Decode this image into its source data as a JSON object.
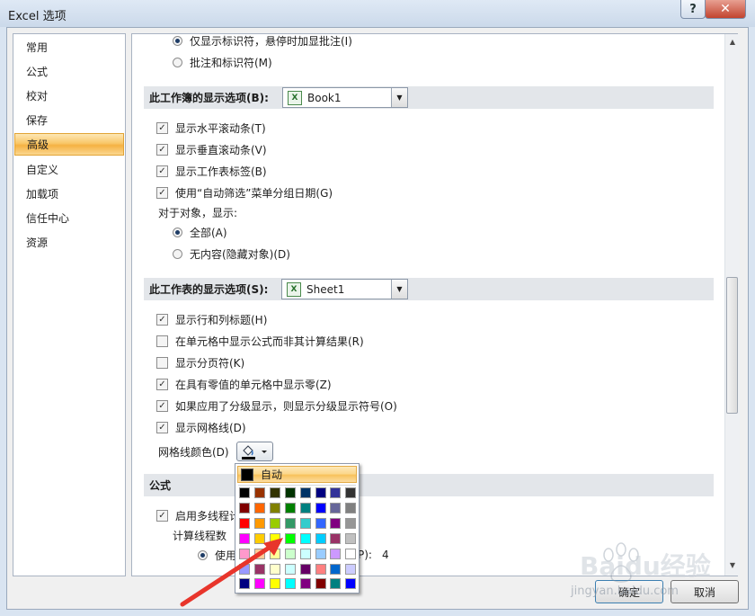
{
  "window": {
    "title": "Excel 选项",
    "help_label": "?",
    "close_label": "✕"
  },
  "nav": {
    "selected_index": 4,
    "items": [
      {
        "label": "常用"
      },
      {
        "label": "公式"
      },
      {
        "label": "校对"
      },
      {
        "label": "保存"
      },
      {
        "label": "高级"
      },
      {
        "label": "自定义"
      },
      {
        "label": "加载项"
      },
      {
        "label": "信任中心"
      },
      {
        "label": "资源"
      }
    ]
  },
  "comments": {
    "radio_indicators_only": "仅显示标识符，悬停时加显批注(I)",
    "radio_comments_and_indicators": "批注和标识符(M)",
    "indicators_only_selected": true,
    "comments_and_indicators_selected": false
  },
  "workbook_section": {
    "heading": "此工作簿的显示选项(B):",
    "combo_value": "Book1",
    "show_horizontal_scrollbar": "显示水平滚动条(T)",
    "show_vertical_scrollbar": "显示垂直滚动条(V)",
    "show_sheet_tabs": "显示工作表标签(B)",
    "group_dates_autofilter": "使用“自动筛选”菜单分组日期(G)",
    "objects_label": "对于对象，显示:",
    "objects_all": "全部(A)",
    "objects_nothing": "无内容(隐藏对象)(D)",
    "objects_all_selected": true,
    "objects_nothing_selected": false
  },
  "worksheet_section": {
    "heading": "此工作表的显示选项(S):",
    "combo_value": "Sheet1",
    "show_row_col_headers": {
      "label": "显示行和列标题(H)",
      "checked": true
    },
    "show_formulas": {
      "label": "在单元格中显示公式而非其计算结果(R)",
      "checked": false
    },
    "show_page_breaks": {
      "label": "显示分页符(K)",
      "checked": false
    },
    "show_zero": {
      "label": "在具有零值的单元格中显示零(Z)",
      "checked": true
    },
    "show_outline_symbols": {
      "label": "如果应用了分级显示，则显示分级显示符号(O)",
      "checked": true
    },
    "show_gridlines": {
      "label": "显示网格线(D)",
      "checked": true
    },
    "gridline_color_label": "网格线颜色(D)"
  },
  "formula_section": {
    "heading": "公式",
    "multithread_label": "启用多线程计",
    "threads_label": "计算线程数",
    "use_label": "使用",
    "p_suffix": "P):",
    "thread_count": "4"
  },
  "color_palette": {
    "auto_label": "自动",
    "auto_color": "#000000",
    "rows": [
      [
        "#000000",
        "#993300",
        "#333300",
        "#003300",
        "#003366",
        "#000080",
        "#333399",
        "#333333"
      ],
      [
        "#800000",
        "#FF6600",
        "#808000",
        "#008000",
        "#008080",
        "#0000FF",
        "#666699",
        "#808080"
      ],
      [
        "#FF0000",
        "#FF9900",
        "#99CC00",
        "#339966",
        "#33CCCC",
        "#3366FF",
        "#800080",
        "#969696"
      ],
      [
        "#FF00FF",
        "#FFCC00",
        "#FFFF00",
        "#00FF00",
        "#00FFFF",
        "#00CCFF",
        "#993366",
        "#C0C0C0"
      ],
      [
        "#FF99CC",
        "#FFCC99",
        "#FFFF99",
        "#CCFFCC",
        "#CCFFFF",
        "#99CCFF",
        "#CC99FF",
        "#FFFFFF"
      ],
      [
        "#9999FF",
        "#993366",
        "#FFFFCC",
        "#CCFFFF",
        "#660066",
        "#FF8080",
        "#0066CC",
        "#CCCCFF"
      ],
      [
        "#000080",
        "#FF00FF",
        "#FFFF00",
        "#00FFFF",
        "#800080",
        "#800000",
        "#008080",
        "#0000FF"
      ]
    ]
  },
  "buttons": {
    "ok": "确定",
    "cancel": "取消"
  },
  "watermark": {
    "brand": "Baidu经验",
    "url": "jingyan.baidu.com"
  }
}
